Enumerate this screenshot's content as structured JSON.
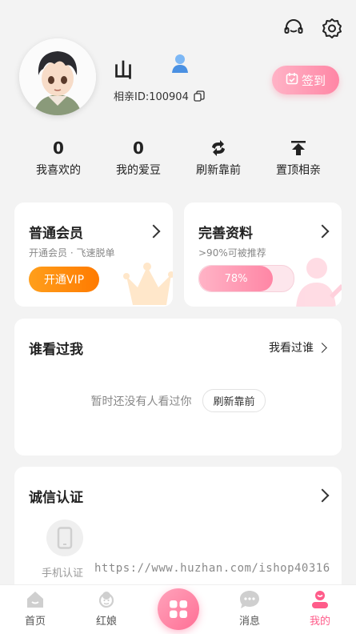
{
  "header": {
    "icons": [
      "headset-icon",
      "gear-icon"
    ]
  },
  "profile": {
    "name": "山",
    "id_label": "相亲ID:100904",
    "checkin_label": "签到"
  },
  "stats": [
    {
      "value": "0",
      "label": "我喜欢的"
    },
    {
      "value": "0",
      "label": "我的爱豆"
    },
    {
      "value": "",
      "label": "刷新靠前"
    },
    {
      "value": "",
      "label": "置顶相亲"
    }
  ],
  "member_card": {
    "title": "普通会员",
    "subtitle": "开通会员 · 飞速脱单",
    "button": "开通VIP"
  },
  "profile_card": {
    "title": "完善资料",
    "subtitle": ">90%可被推荐",
    "progress_label": "78%",
    "progress": 0.78
  },
  "visitors": {
    "title": "谁看过我",
    "link": "我看过谁",
    "empty_text": "暂时还没有人看过你",
    "refresh_button": "刷新靠前"
  },
  "verification": {
    "title": "诚信认证",
    "items": [
      {
        "label": "手机认证"
      }
    ]
  },
  "watermark": "https://www.huzhan.com/ishop40316",
  "tabbar": {
    "items": [
      {
        "label": "首页"
      },
      {
        "label": "红娘"
      },
      {
        "label": ""
      },
      {
        "label": "消息"
      },
      {
        "label": "我的"
      }
    ],
    "active_color": "#ff5c8a"
  },
  "colors": {
    "accent": "#ff86a5",
    "vip": "#ff8a00"
  }
}
